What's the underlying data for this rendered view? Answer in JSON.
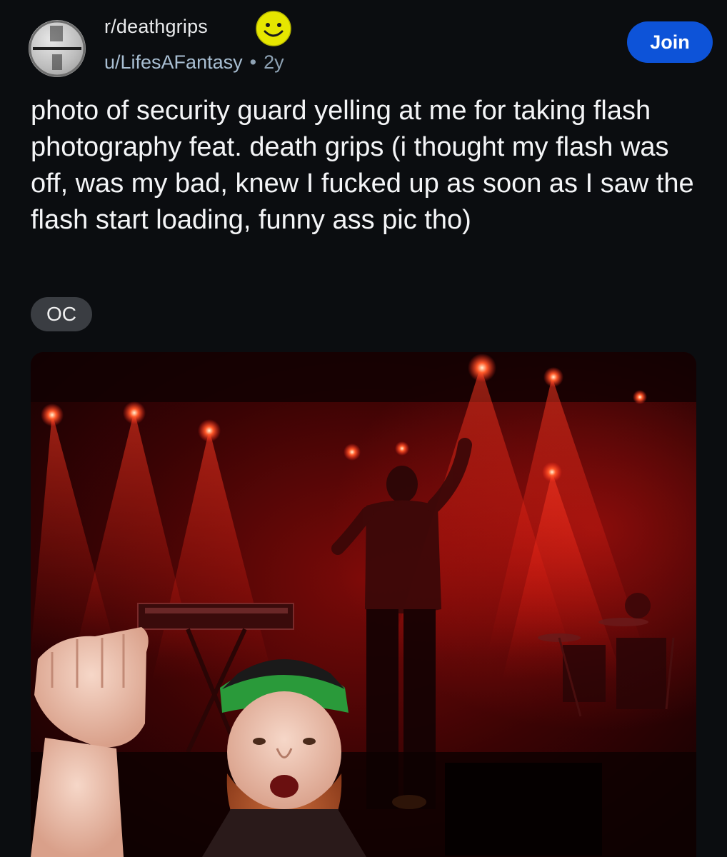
{
  "post": {
    "subreddit": "r/deathgrips",
    "author": "u/LifesAFantasy",
    "separator": "•",
    "age": "2y",
    "join_label": "Join",
    "title": "photo of security guard yelling at me for taking flash photography feat. death grips (i thought my flash was off, was my bad, knew I fucked up as soon as I saw the flash start loading, funny ass pic tho)",
    "flair": "OC"
  },
  "icons": {
    "subreddit_avatar": "subreddit-avatar-icon",
    "smiley": "smiley-emoji-icon"
  },
  "colors": {
    "background": "#0b0d10",
    "join_button": "#0d53d8",
    "meta_text": "#8ea2b4",
    "flair_bg": "#3a3d42",
    "stage_light": "#ff2a1a"
  }
}
